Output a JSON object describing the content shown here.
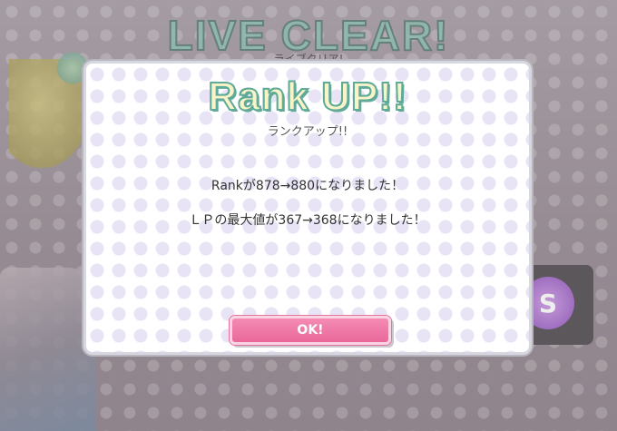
{
  "background": {
    "title": "LIVE CLEAR!",
    "subtitle": "ライブクリア!"
  },
  "dialog": {
    "title": "Rank UP!!",
    "subtitle": "ランクアップ!!",
    "messages": [
      "Rankが878→880になりました！",
      "ＬＰの最大値が367→368になりました！"
    ],
    "ok_label": "OK!"
  },
  "side_badge_text": "S",
  "colors": {
    "title_fill": "#f9f4c8",
    "title_outline": "#5faa98",
    "ok_button": "#e9689a"
  }
}
